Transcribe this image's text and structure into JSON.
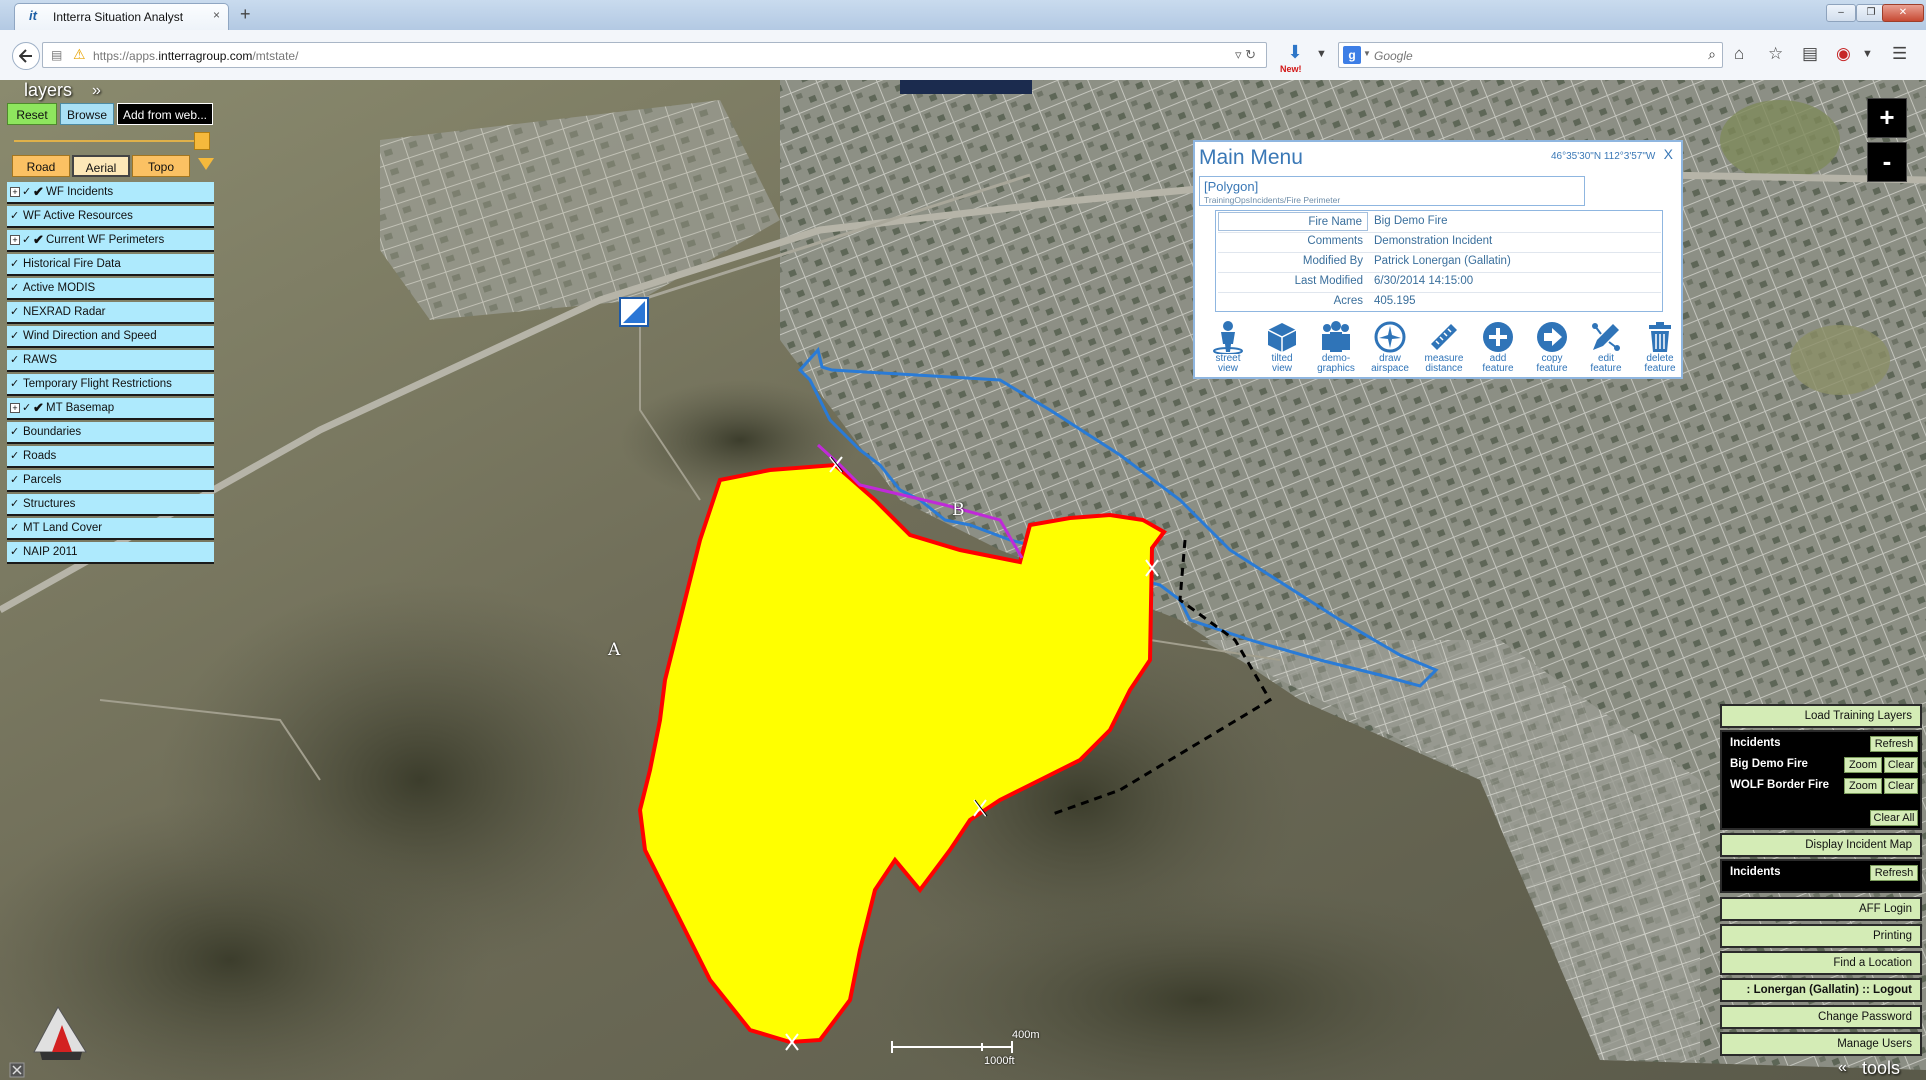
{
  "browser": {
    "tab_title": "Intterra Situation Analyst",
    "tab_favicon": "it",
    "tab_close": "×",
    "new_tab": "+",
    "url_prefix": "https://apps.",
    "url_domain": "intterragroup.com",
    "url_path": "/mtstate/",
    "download_badge": "New!",
    "search_engine": "g",
    "search_placeholder": "Google",
    "window_buttons": [
      "–",
      "❐",
      "✕"
    ]
  },
  "layers_panel": {
    "title": "layers",
    "collapse_icon": "»",
    "reset_label": "Reset",
    "browse_label": "Browse",
    "add_web_label": "Add from web...",
    "basemaps": [
      "Road",
      "Aerial",
      "Topo"
    ],
    "active_basemap": "Aerial",
    "opacity": 1.0,
    "items": [
      {
        "label": "WF Incidents",
        "expandable": true,
        "visible": true
      },
      {
        "label": "WF Active Resources",
        "expandable": false,
        "visible": false
      },
      {
        "label": "Current WF Perimeters",
        "expandable": true,
        "visible": true
      },
      {
        "label": "Historical Fire Data",
        "expandable": false,
        "visible": false
      },
      {
        "label": "Active MODIS",
        "expandable": false,
        "visible": false
      },
      {
        "label": "NEXRAD Radar",
        "expandable": false,
        "visible": false
      },
      {
        "label": "Wind Direction and Speed",
        "expandable": false,
        "visible": false
      },
      {
        "label": "RAWS",
        "expandable": false,
        "visible": false
      },
      {
        "label": "Temporary Flight Restrictions",
        "expandable": false,
        "visible": false
      },
      {
        "label": "MT Basemap",
        "expandable": true,
        "visible": true
      },
      {
        "label": "Boundaries",
        "expandable": false,
        "visible": false
      },
      {
        "label": "Roads",
        "expandable": false,
        "visible": false
      },
      {
        "label": "Parcels",
        "expandable": false,
        "visible": false
      },
      {
        "label": "Structures",
        "expandable": false,
        "visible": false
      },
      {
        "label": "MT Land Cover",
        "expandable": false,
        "visible": false
      },
      {
        "label": "NAIP 2011",
        "expandable": false,
        "visible": false
      }
    ]
  },
  "zoom": {
    "in_label": "+",
    "out_label": "-"
  },
  "main_menu": {
    "title": "Main Menu",
    "coords": "46°35'30\"N 112°3'57\"W",
    "close_label": "X",
    "feature_type": "[Polygon]",
    "feature_path": "TrainingOpsIncidents/Fire Perimeter",
    "attributes": [
      {
        "key": "Fire Name",
        "value": "Big Demo Fire"
      },
      {
        "key": "Comments",
        "value": "Demonstration Incident"
      },
      {
        "key": "Modified By",
        "value": "Patrick Lonergan (Gallatin)"
      },
      {
        "key": "Last Modified",
        "value": "6/30/2014 14:15:00"
      },
      {
        "key": "Acres",
        "value": "405.195"
      }
    ],
    "tools": [
      {
        "line1": "street",
        "line2": "view",
        "icon": "street-view-icon"
      },
      {
        "line1": "tilted",
        "line2": "view",
        "icon": "tilted-view-icon"
      },
      {
        "line1": "demo-",
        "line2": "graphics",
        "icon": "demographics-icon"
      },
      {
        "line1": "draw",
        "line2": "airspace",
        "icon": "airspace-icon"
      },
      {
        "line1": "measure",
        "line2": "distance",
        "icon": "ruler-icon"
      },
      {
        "line1": "add",
        "line2": "feature",
        "icon": "add-icon"
      },
      {
        "line1": "copy",
        "line2": "feature",
        "icon": "copy-icon"
      },
      {
        "line1": "edit",
        "line2": "feature",
        "icon": "edit-icon"
      },
      {
        "line1": "delete",
        "line2": "feature",
        "icon": "trash-icon"
      }
    ]
  },
  "incident_panel": {
    "load_training_label": "Load Training Layers",
    "incidents_header": "Incidents",
    "refresh_label": "Refresh",
    "zoom_label": "Zoom",
    "clear_label": "Clear",
    "clear_all_label": "Clear All",
    "incidents": [
      "Big Demo Fire",
      "WOLF Border Fire"
    ],
    "display_incident_map_label": "Display Incident Map",
    "incidents_header_2": "Incidents",
    "refresh_label_2": "Refresh",
    "aff_login_label": "AFF Login",
    "printing_label": "Printing",
    "find_location_label": "Find a Location",
    "user_label": ": Lonergan (Gallatin) :: Logout",
    "change_password_label": "Change Password",
    "manage_users_label": "Manage Users",
    "tools_label": "tools",
    "tools_arrow": "«"
  },
  "map": {
    "scale_top": "400m",
    "scale_bottom": "1000ft",
    "marker_a": "A",
    "marker_b": "B",
    "perimeter_fill": "#ffff00",
    "perimeter_stroke": "#ff0000",
    "line_blue": "#2a7bd6",
    "line_purple": "#c02ad8"
  }
}
